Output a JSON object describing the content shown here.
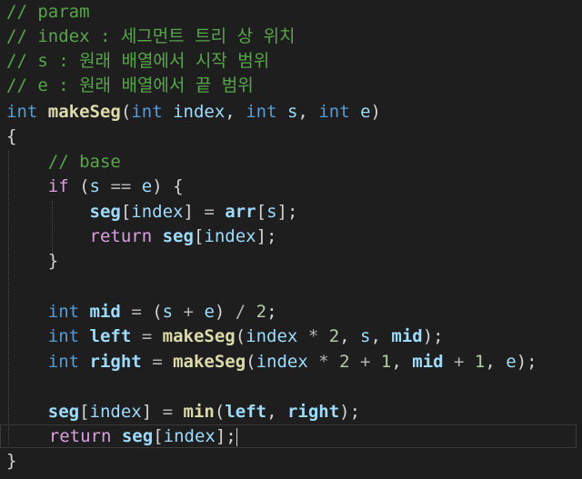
{
  "editor": {
    "language": "C++",
    "theme_colors": {
      "background": "#1e1e1e",
      "comment": "#57a64a",
      "keyword": "#569cd6",
      "control": "#d8a0df",
      "function": "#dcdcaa",
      "variable": "#9cdcfe",
      "number": "#b5cea8"
    },
    "comments": {
      "c1": "// param",
      "c2": "// index : 세그먼트 트리 상 위치",
      "c3": "// s : 원래 배열에서 시작 범위",
      "c4": "// e : 원래 배열에서 끝 범위",
      "base": "// base"
    },
    "tokens": {
      "int": "int",
      "if": "if",
      "return": "return",
      "fn": "makeSeg",
      "min": "min",
      "index": "index",
      "s": "s",
      "e": "e",
      "seg": "seg",
      "arr": "arr",
      "mid": "mid",
      "left": "left",
      "right": "right",
      "two": "2",
      "one": "1"
    }
  }
}
